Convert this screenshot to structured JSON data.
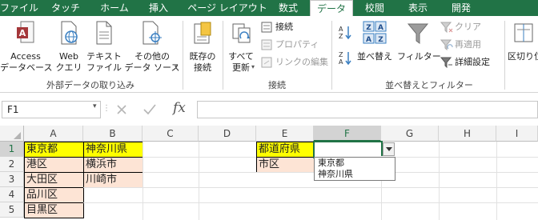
{
  "tabs": [
    {
      "label": "ファイル",
      "active": false
    },
    {
      "label": "タッチ",
      "active": false
    },
    {
      "label": "ホーム",
      "active": false
    },
    {
      "label": "挿入",
      "active": false
    },
    {
      "label": "ページ レイアウト",
      "active": false
    },
    {
      "label": "数式",
      "active": false
    },
    {
      "label": "データ",
      "active": true
    },
    {
      "label": "校閲",
      "active": false
    },
    {
      "label": "表示",
      "active": false
    },
    {
      "label": "開発",
      "active": false
    }
  ],
  "ribbon": {
    "access_line1": "Access",
    "access_line2": "データベース",
    "web_line1": "Web",
    "web_line2": "クエリ",
    "text_line1": "テキスト",
    "text_line2": "ファイル",
    "other_line1": "その他の",
    "other_line2": "データ ソース",
    "group_external": "外部データの取り込み",
    "existing_line1": "既存の",
    "existing_line2": "接続",
    "refresh_line1": "すべて",
    "refresh_line2": "更新",
    "connections": "接続",
    "properties": "プロパティ",
    "edit_links": "リンクの編集",
    "group_connections": "接続",
    "sort": "並べ替え",
    "filter": "フィルター",
    "clear": "クリア",
    "reapply": "再適用",
    "advanced": "詳細設定",
    "group_sort_filter": "並べ替えとフィルター",
    "text_to_columns": "区切り位"
  },
  "formula_bar": {
    "name_box": "F1",
    "fx": "fx",
    "formula_value": ""
  },
  "columns": [
    "A",
    "B",
    "C",
    "D",
    "E",
    "F",
    "G",
    "H",
    "I"
  ],
  "selected_column": "F",
  "rows": [
    "1",
    "2",
    "3",
    "4",
    "5"
  ],
  "selected_row": "1",
  "cells": {
    "A1": "東京都",
    "A2": "港区",
    "A3": "大田区",
    "A4": "品川区",
    "A5": "目黒区",
    "B1": "神奈川県",
    "B2": "横浜市",
    "B3": "川崎市",
    "E1": "都道府県",
    "E2": "市区"
  },
  "dropdown": {
    "options": [
      "東京都",
      "神奈川県"
    ]
  },
  "colors": {
    "excel_green": "#217346",
    "header_yellow": "#ffff00",
    "cell_pink": "#fde4d5"
  }
}
